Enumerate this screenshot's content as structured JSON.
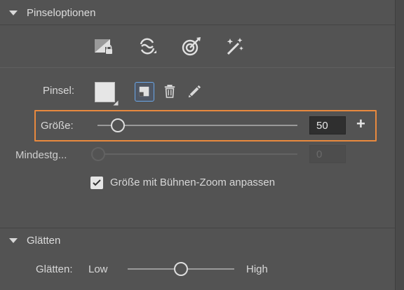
{
  "brush_options": {
    "title": "Pinseloptionen",
    "tool_icons": [
      "lock-brush-icon",
      "brush-mode-icon",
      "target-brush-icon",
      "magic-wand-icon"
    ],
    "brush_label": "Pinsel:",
    "size_label": "Größe:",
    "size_value": "50",
    "size_fraction": 0.1,
    "min_size_label": "Mindestg...",
    "min_size_value": "0",
    "checkbox_label": "Größe mit Bühnen-Zoom anpassen",
    "checkbox_checked": true
  },
  "smoothing": {
    "title": "Glätten",
    "label": "Glätten:",
    "low_label": "Low",
    "high_label": "High",
    "fraction": 0.5
  },
  "colors": {
    "highlight": "#e8893e",
    "selected": "#6aa6e8"
  }
}
